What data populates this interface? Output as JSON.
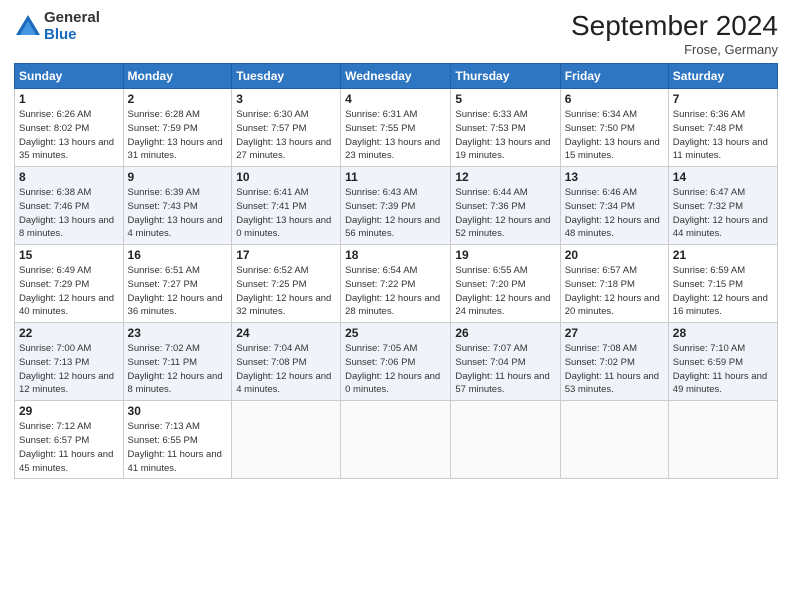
{
  "header": {
    "logo_line1": "General",
    "logo_line2": "Blue",
    "month_title": "September 2024",
    "subtitle": "Frose, Germany"
  },
  "days_of_week": [
    "Sunday",
    "Monday",
    "Tuesday",
    "Wednesday",
    "Thursday",
    "Friday",
    "Saturday"
  ],
  "weeks": [
    [
      {
        "day": "1",
        "sunrise": "6:26 AM",
        "sunset": "8:02 PM",
        "daylight": "13 hours and 35 minutes."
      },
      {
        "day": "2",
        "sunrise": "6:28 AM",
        "sunset": "7:59 PM",
        "daylight": "13 hours and 31 minutes."
      },
      {
        "day": "3",
        "sunrise": "6:30 AM",
        "sunset": "7:57 PM",
        "daylight": "13 hours and 27 minutes."
      },
      {
        "day": "4",
        "sunrise": "6:31 AM",
        "sunset": "7:55 PM",
        "daylight": "13 hours and 23 minutes."
      },
      {
        "day": "5",
        "sunrise": "6:33 AM",
        "sunset": "7:53 PM",
        "daylight": "13 hours and 19 minutes."
      },
      {
        "day": "6",
        "sunrise": "6:34 AM",
        "sunset": "7:50 PM",
        "daylight": "13 hours and 15 minutes."
      },
      {
        "day": "7",
        "sunrise": "6:36 AM",
        "sunset": "7:48 PM",
        "daylight": "13 hours and 11 minutes."
      }
    ],
    [
      {
        "day": "8",
        "sunrise": "6:38 AM",
        "sunset": "7:46 PM",
        "daylight": "13 hours and 8 minutes."
      },
      {
        "day": "9",
        "sunrise": "6:39 AM",
        "sunset": "7:43 PM",
        "daylight": "13 hours and 4 minutes."
      },
      {
        "day": "10",
        "sunrise": "6:41 AM",
        "sunset": "7:41 PM",
        "daylight": "13 hours and 0 minutes."
      },
      {
        "day": "11",
        "sunrise": "6:43 AM",
        "sunset": "7:39 PM",
        "daylight": "12 hours and 56 minutes."
      },
      {
        "day": "12",
        "sunrise": "6:44 AM",
        "sunset": "7:36 PM",
        "daylight": "12 hours and 52 minutes."
      },
      {
        "day": "13",
        "sunrise": "6:46 AM",
        "sunset": "7:34 PM",
        "daylight": "12 hours and 48 minutes."
      },
      {
        "day": "14",
        "sunrise": "6:47 AM",
        "sunset": "7:32 PM",
        "daylight": "12 hours and 44 minutes."
      }
    ],
    [
      {
        "day": "15",
        "sunrise": "6:49 AM",
        "sunset": "7:29 PM",
        "daylight": "12 hours and 40 minutes."
      },
      {
        "day": "16",
        "sunrise": "6:51 AM",
        "sunset": "7:27 PM",
        "daylight": "12 hours and 36 minutes."
      },
      {
        "day": "17",
        "sunrise": "6:52 AM",
        "sunset": "7:25 PM",
        "daylight": "12 hours and 32 minutes."
      },
      {
        "day": "18",
        "sunrise": "6:54 AM",
        "sunset": "7:22 PM",
        "daylight": "12 hours and 28 minutes."
      },
      {
        "day": "19",
        "sunrise": "6:55 AM",
        "sunset": "7:20 PM",
        "daylight": "12 hours and 24 minutes."
      },
      {
        "day": "20",
        "sunrise": "6:57 AM",
        "sunset": "7:18 PM",
        "daylight": "12 hours and 20 minutes."
      },
      {
        "day": "21",
        "sunrise": "6:59 AM",
        "sunset": "7:15 PM",
        "daylight": "12 hours and 16 minutes."
      }
    ],
    [
      {
        "day": "22",
        "sunrise": "7:00 AM",
        "sunset": "7:13 PM",
        "daylight": "12 hours and 12 minutes."
      },
      {
        "day": "23",
        "sunrise": "7:02 AM",
        "sunset": "7:11 PM",
        "daylight": "12 hours and 8 minutes."
      },
      {
        "day": "24",
        "sunrise": "7:04 AM",
        "sunset": "7:08 PM",
        "daylight": "12 hours and 4 minutes."
      },
      {
        "day": "25",
        "sunrise": "7:05 AM",
        "sunset": "7:06 PM",
        "daylight": "12 hours and 0 minutes."
      },
      {
        "day": "26",
        "sunrise": "7:07 AM",
        "sunset": "7:04 PM",
        "daylight": "11 hours and 57 minutes."
      },
      {
        "day": "27",
        "sunrise": "7:08 AM",
        "sunset": "7:02 PM",
        "daylight": "11 hours and 53 minutes."
      },
      {
        "day": "28",
        "sunrise": "7:10 AM",
        "sunset": "6:59 PM",
        "daylight": "11 hours and 49 minutes."
      }
    ],
    [
      {
        "day": "29",
        "sunrise": "7:12 AM",
        "sunset": "6:57 PM",
        "daylight": "11 hours and 45 minutes."
      },
      {
        "day": "30",
        "sunrise": "7:13 AM",
        "sunset": "6:55 PM",
        "daylight": "11 hours and 41 minutes."
      },
      null,
      null,
      null,
      null,
      null
    ]
  ]
}
